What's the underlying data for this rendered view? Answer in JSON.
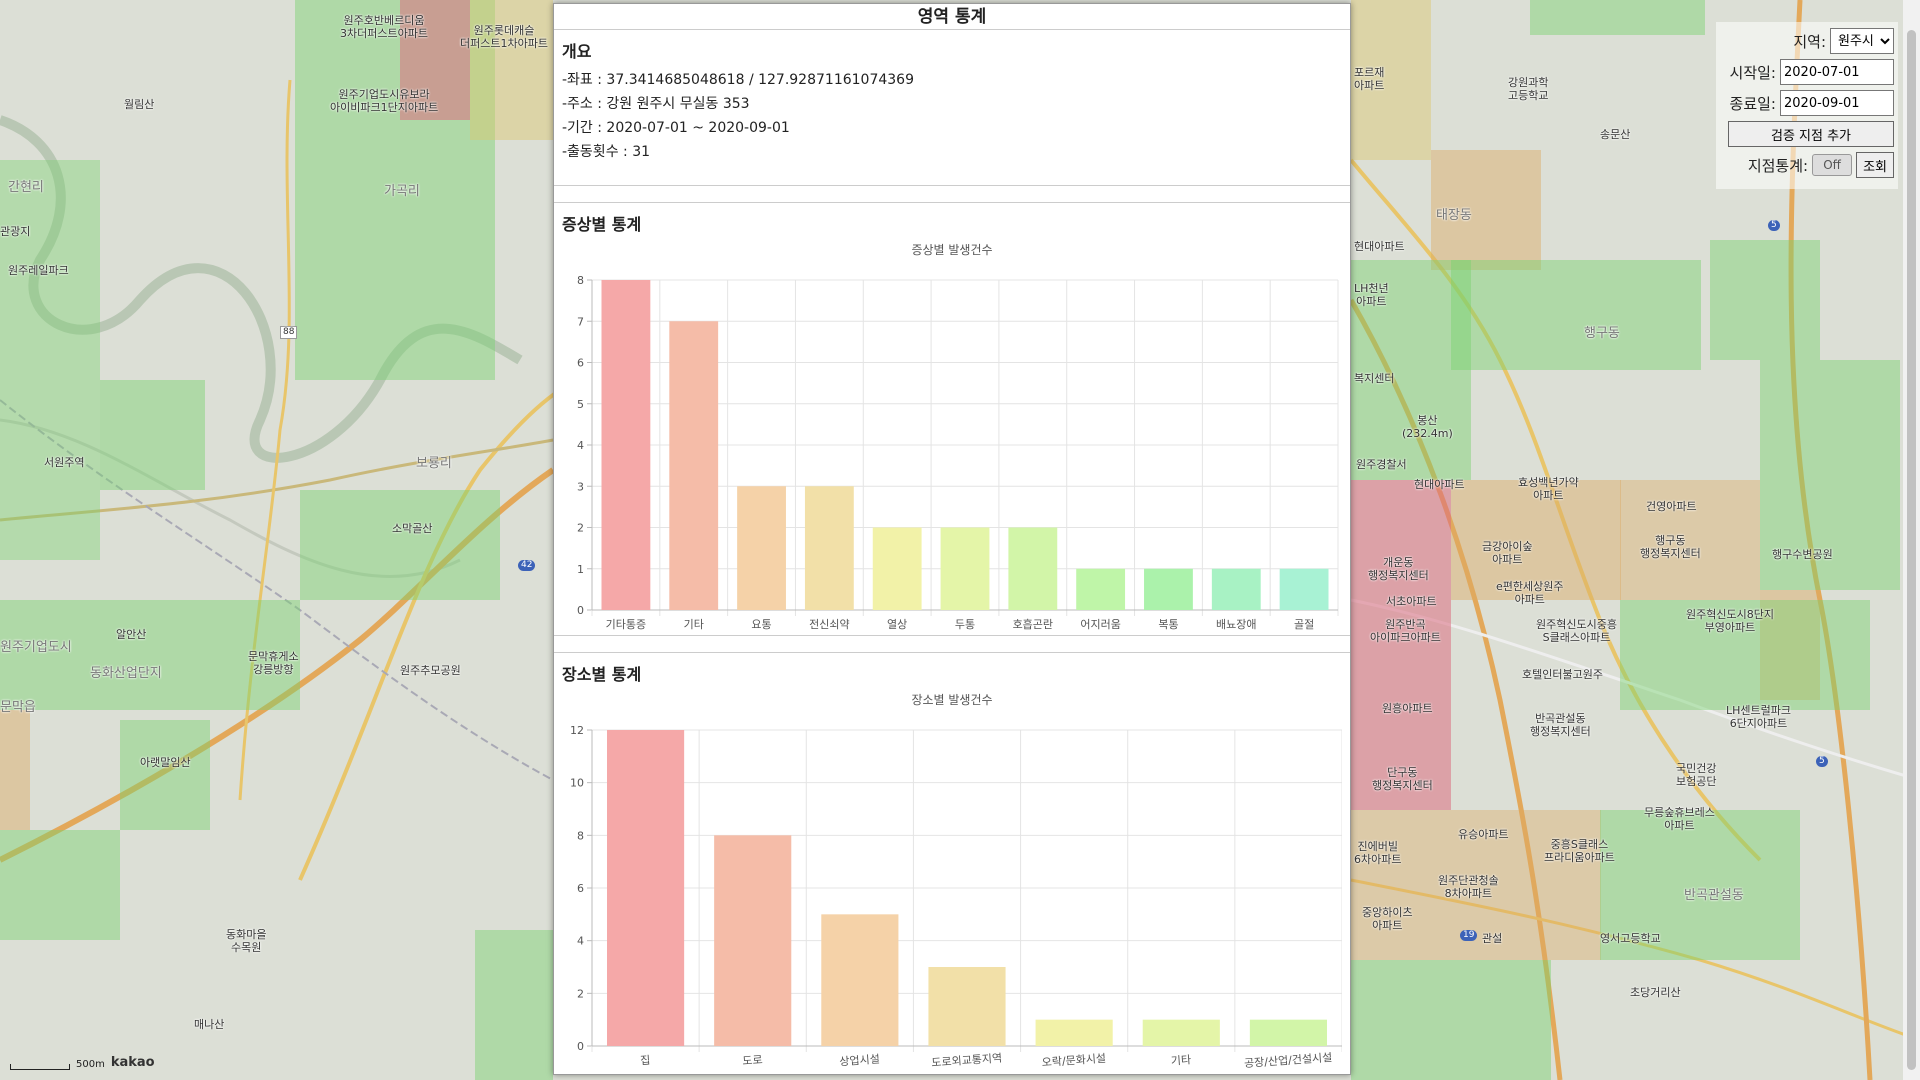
{
  "map": {
    "labels": [
      {
        "text": "원주호반베르디움\n3차더퍼스트아파트"
      },
      {
        "text": "원주롯데캐슬\n더퍼스트1차아파트"
      },
      {
        "text": "원주기업도시유보라\n아이비파크1단지아파트"
      },
      {
        "text": "월림산"
      },
      {
        "text": "관광지"
      },
      {
        "text": "원주레일파크"
      },
      {
        "text": "서원주역"
      },
      {
        "text": "소막골산"
      },
      {
        "text": "알안산"
      },
      {
        "text": "문막휴게소\n강릉방향"
      },
      {
        "text": "원주추모공원"
      },
      {
        "text": "아랫말임산"
      },
      {
        "text": "동화마을\n수목원"
      },
      {
        "text": "매나산"
      },
      {
        "text": "강원과학\n고등학교"
      },
      {
        "text": "송문산"
      },
      {
        "text": "봉산\n(232.4m)"
      },
      {
        "text": "원주경찰서"
      },
      {
        "text": "현대아파트"
      },
      {
        "text": "개운동\n행정복지센터"
      },
      {
        "text": "서초아파트"
      },
      {
        "text": "금강아이숲\n아파트"
      },
      {
        "text": "효성백년가약\n아파트"
      },
      {
        "text": "건영아파트"
      },
      {
        "text": "행구동\n행정복지센터"
      },
      {
        "text": "행구수변공원"
      },
      {
        "text": "e편한세상원주\n아파트"
      },
      {
        "text": "원주반곡\n아이파크아파트"
      },
      {
        "text": "원주혁신도시중흥\nS클래스아파트"
      },
      {
        "text": "원주혁신도시8단지\n부영아파트"
      },
      {
        "text": "호텔인터불고원주"
      },
      {
        "text": "원흥아파트"
      },
      {
        "text": "단구동\n행정복지센터"
      },
      {
        "text": "반곡관설동\n행정복지센터"
      },
      {
        "text": "LH센트럴파크\n6단지아파트"
      },
      {
        "text": "국민건강\n보험공단"
      },
      {
        "text": "유승아파트"
      },
      {
        "text": "중흥S클래스\n프라디움아파트"
      },
      {
        "text": "무릉숲휴브레스\n아파트"
      },
      {
        "text": "원주단관청솔\n8차아파트"
      },
      {
        "text": "중앙하이츠\n아파트"
      },
      {
        "text": "관설"
      },
      {
        "text": "영서고등학교"
      },
      {
        "text": "초당거리산"
      },
      {
        "text": "포르재\n아파트"
      },
      {
        "text": "현대아파트"
      },
      {
        "text": "LH천년\n아파트"
      },
      {
        "text": "복지센터"
      },
      {
        "text": "진에버빌\n6차아파트"
      }
    ],
    "region_labels": [
      "간현리",
      "가곡리",
      "보룡리",
      "동화산업단지",
      "태장동",
      "행구동",
      "반곡관설동",
      "원주기업도시",
      "문막읍"
    ],
    "road_numbers": [
      "88",
      "42",
      "5",
      "5",
      "19"
    ],
    "scale_text": "500m",
    "brand": "kakao"
  },
  "controls": {
    "region_label": "지역:",
    "region_value": "원주시",
    "start_label": "시작일:",
    "start_value": "2020-07-01",
    "end_label": "종료일:",
    "end_value": "2020-09-01",
    "add_button": "검증 지점 추가",
    "point_stats_label": "지점통계:",
    "toggle_text": "Off",
    "query_button": "조회"
  },
  "modal": {
    "title": "영역 통계",
    "overview": {
      "heading": "개요",
      "coords": "-좌표 : 37.3414685048618 / 127.92871161074369",
      "address": "-주소 : 강원 원주시 무실동 353",
      "period": "-기간 : 2020-07-01 ~ 2020-09-01",
      "dispatch": "-출동횟수 : 31"
    },
    "symptom": {
      "heading": "증상별 통계"
    },
    "place": {
      "heading": "장소별 통계"
    }
  },
  "chart_data": [
    {
      "type": "bar",
      "title": "증상별 발생건수",
      "categories": [
        "기타통증",
        "기타",
        "요통",
        "전신쇠약",
        "열상",
        "두통",
        "호흡곤란",
        "어지러움",
        "복통",
        "배뇨장애",
        "골절"
      ],
      "values": [
        8,
        7,
        3,
        3,
        2,
        2,
        2,
        1,
        1,
        1,
        1
      ],
      "ylim": [
        0,
        8
      ],
      "yticks": [
        0,
        1,
        2,
        3,
        4,
        5,
        6,
        7,
        8
      ],
      "grid": true,
      "colors": [
        "#f5a8a8",
        "#f5bca8",
        "#f5d2a8",
        "#f2e0a8",
        "#f2f2a8",
        "#e4f5a8",
        "#d2f5a8",
        "#bff5a8",
        "#abf2ab",
        "#a8f2c4",
        "#a8f2d4"
      ]
    },
    {
      "type": "bar",
      "title": "장소별 발생건수",
      "categories": [
        "집",
        "도로",
        "상업시설",
        "도로외교통지역",
        "오락/문화시설",
        "기타",
        "공장/산업/건설시설"
      ],
      "values": [
        12,
        8,
        5,
        3,
        1,
        1,
        1
      ],
      "ylim": [
        0,
        12
      ],
      "yticks": [
        0,
        2,
        4,
        6,
        8,
        10,
        12
      ],
      "grid": true,
      "colors": [
        "#f5a8a8",
        "#f5bca8",
        "#f5d2a8",
        "#f2e0a8",
        "#f2f2a8",
        "#e4f5a8",
        "#d2f5a8"
      ]
    }
  ]
}
